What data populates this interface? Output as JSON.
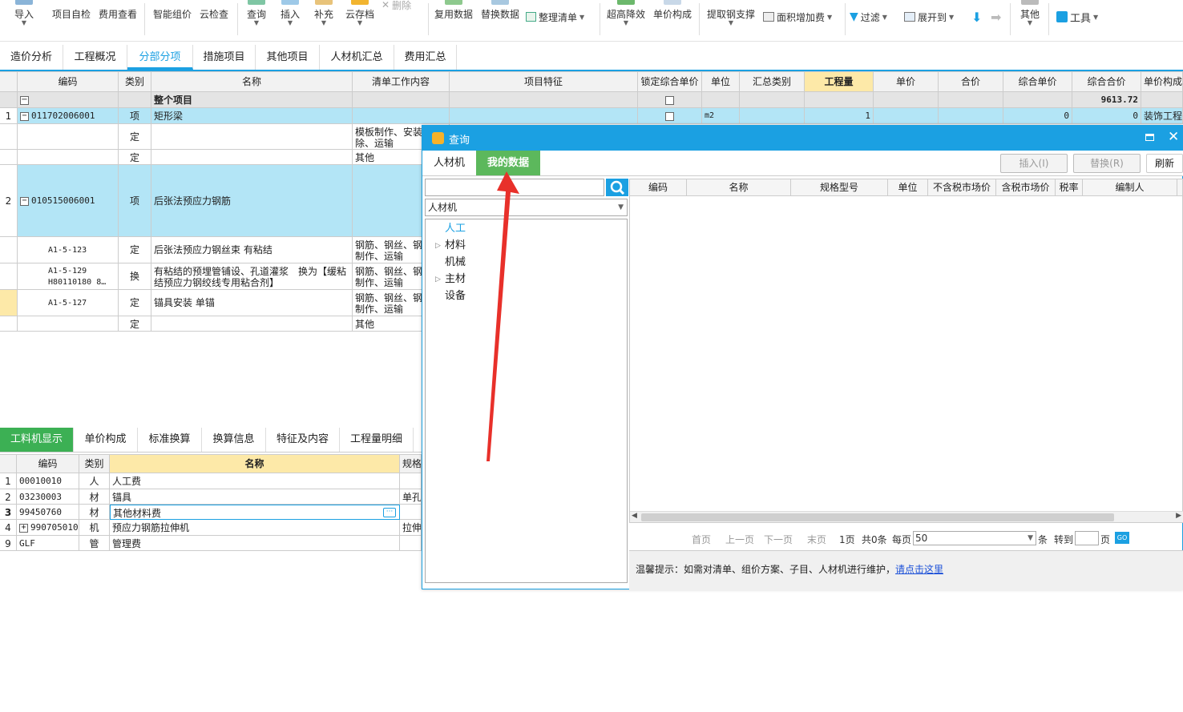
{
  "toolbar": {
    "items": [
      "导入",
      "项目自检",
      "费用查看",
      "智能组价",
      "云检查",
      "查询",
      "插入",
      "补充",
      "云存档",
      "删除",
      "复用数据",
      "替换数据",
      "整理清单",
      "超高降效",
      "单价构成",
      "提取钢支撑",
      "面积增加费",
      "过滤",
      "展开到",
      "其他",
      "工具"
    ]
  },
  "tabs": [
    "造价分析",
    "工程概况",
    "分部分项",
    "措施项目",
    "其他项目",
    "人材机汇总",
    "费用汇总"
  ],
  "grid": {
    "headers": [
      "编码",
      "类别",
      "名称",
      "清单工作内容",
      "项目特征",
      "锁定综合单价",
      "单位",
      "汇总类别",
      "工程量",
      "单价",
      "合价",
      "综合单价",
      "综合合价",
      "单价构成"
    ],
    "root_label": "整个项目",
    "root_total": "9613.72",
    "rows": [
      {
        "no": "1",
        "code": "011702006001",
        "type": "项",
        "name": "矩形梁",
        "work": "",
        "unit": "m2",
        "qty": "1",
        "zh_price": "0",
        "zh_total": "0",
        "price_comp": "装饰工程"
      },
      {
        "no": "",
        "code": "",
        "type": "定",
        "name": "",
        "work": "模板制作、安装、拆除、运输"
      },
      {
        "no": "",
        "code": "",
        "type": "定",
        "name": "",
        "work": "其他"
      },
      {
        "no": "2",
        "code": "010515006001",
        "type": "项",
        "name": "后张法预应力钢筋",
        "work": ""
      },
      {
        "no": "",
        "code": "A1-5-123",
        "type": "定",
        "name": "后张法预应力钢丝束 有粘结",
        "work": "钢筋、钢丝、钢绞线制作、运输"
      },
      {
        "no": "",
        "code": "A1-5-129 H80110180 8…",
        "type": "换",
        "name": "有粘结的预埋管铺设、孔道灌浆　换为【缓粘结预应力钢绞线专用粘合剂】",
        "work": "钢筋、钢丝、钢绞线制作、运输"
      },
      {
        "no": "",
        "code": "A1-5-127",
        "type": "定",
        "name": "锚具安装 单锚",
        "work": "钢筋、钢丝、钢绞线制作、运输"
      },
      {
        "no": "",
        "code": "",
        "type": "定",
        "name": "",
        "work": "其他"
      }
    ]
  },
  "bottom": {
    "tabs": [
      "工料机显示",
      "单价构成",
      "标准换算",
      "换算信息",
      "特征及内容",
      "工程量明细"
    ],
    "headers": [
      "编码",
      "类别",
      "名称",
      "规格"
    ],
    "rows": [
      {
        "no": "1",
        "code": "00010010",
        "type": "人",
        "name": "人工费",
        "spec": ""
      },
      {
        "no": "2",
        "code": "03230003",
        "type": "材",
        "name": "锚具",
        "spec": "单孔"
      },
      {
        "no": "3",
        "code": "99450760",
        "type": "材",
        "name": "其他材料费",
        "spec": ""
      },
      {
        "no": "4",
        "code": "990705010",
        "type": "机",
        "name": "预应力钢筋拉伸机",
        "spec": "拉伸"
      },
      {
        "no": "9",
        "code": "GLF",
        "type": "管",
        "name": "管理费",
        "spec": ""
      }
    ]
  },
  "dialog": {
    "title": "查询",
    "tabs": [
      "人材机",
      "我的数据"
    ],
    "buttons": [
      "插入(I)",
      "替换(R)",
      "刷新"
    ],
    "search_placeholder": "",
    "select_value": "人材机",
    "tree": [
      "人工",
      "材料",
      "机械",
      "主材",
      "设备"
    ],
    "headers": [
      "编码",
      "名称",
      "规格型号",
      "单位",
      "不含税市场价",
      "含税市场价",
      "税率",
      "编制人"
    ],
    "pager": {
      "first": "首页",
      "prev": "上一页",
      "next": "下一页",
      "last": "末页",
      "pages": "1页",
      "count": "共0条",
      "per_page_label": "每页",
      "per_page": "50",
      "unit": "条",
      "goto": "转到",
      "page_unit": "页",
      "go": "GO"
    },
    "tip_text": "温馨提示：如需对清单、组价方案、子目、人材机进行维护，",
    "tip_link": "请点击这里"
  },
  "colors": {
    "accent": "#1ba0e2",
    "active_tab_green": "#5cb85c",
    "row_highlight": "#b3e5f6",
    "arrow": "#e8302a"
  }
}
